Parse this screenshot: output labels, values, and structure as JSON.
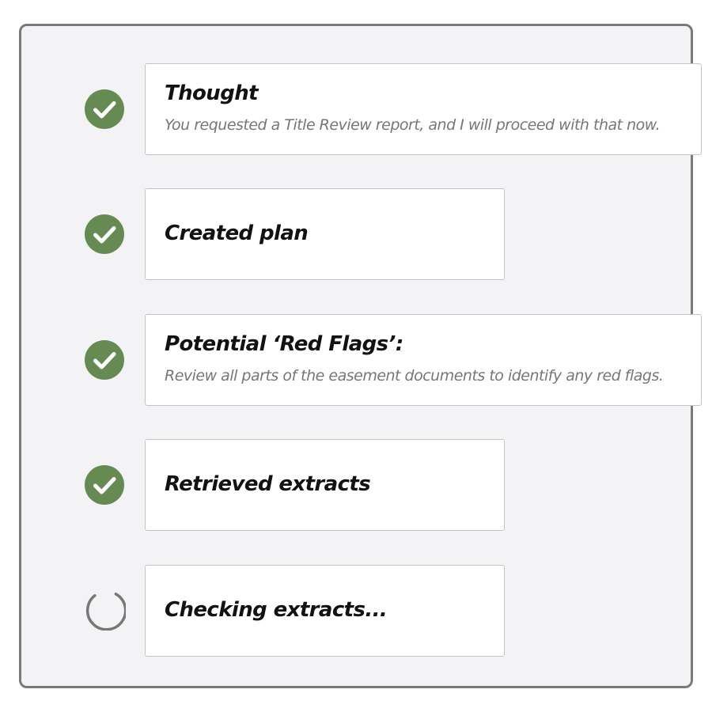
{
  "colors": {
    "check": "#658b52",
    "spinner": "#777777",
    "panel_bg": "#f3f3f5",
    "panel_border": "#7a7a7a"
  },
  "steps": [
    {
      "status": "complete",
      "icon": "check-circle-icon",
      "title": "Thought",
      "subtitle": "You requested a Title Review report, and I will proceed with that now."
    },
    {
      "status": "complete",
      "icon": "check-circle-icon",
      "title": "Created plan"
    },
    {
      "status": "complete",
      "icon": "check-circle-icon",
      "title": "Potential ‘Red Flags’:",
      "subtitle": "Review all parts of the easement documents to identify any red flags."
    },
    {
      "status": "complete",
      "icon": "check-circle-icon",
      "title": "Retrieved extracts"
    },
    {
      "status": "in-progress",
      "icon": "loading-spinner-icon",
      "title": "Checking extracts..."
    }
  ]
}
